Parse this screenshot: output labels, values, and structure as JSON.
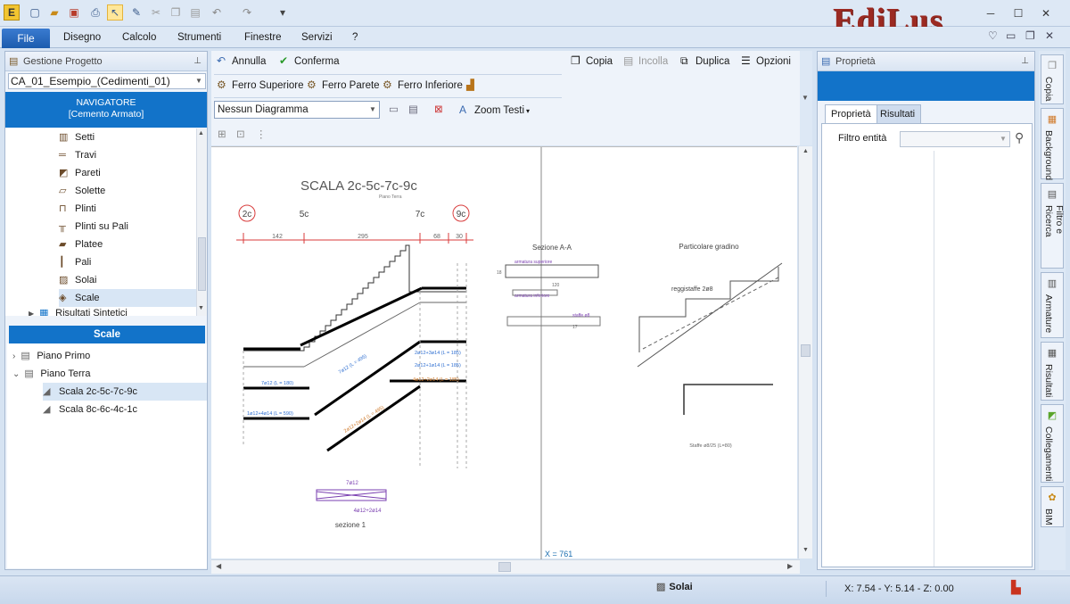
{
  "app": {
    "logo": "EdiLus"
  },
  "quick_access": {
    "icons": [
      "app-menu-icon",
      "new-icon",
      "open-icon",
      "save-icon",
      "print-icon",
      "select-icon",
      "tool-icon",
      "cut-icon",
      "copy-icon",
      "paste-icon",
      "undo-icon",
      "redo-icon",
      "customize-icon"
    ]
  },
  "menu": {
    "file": "File",
    "items": [
      "Disegno",
      "Calcolo",
      "Strumenti",
      "Finestre",
      "Servizi",
      "?"
    ]
  },
  "left_panel": {
    "header": "Gestione Progetto",
    "project_combo": "CA_01_Esempio_(Cedimenti_01)",
    "navigator_title": "NAVIGATORE",
    "navigator_subtitle": "[Cemento Armato]",
    "tree_items": [
      "Setti",
      "Travi",
      "Pareti",
      "Solette",
      "Plinti",
      "Plinti su Pali",
      "Platee",
      "Pali",
      "Solai",
      "Scale",
      "Risultati Sintetici"
    ],
    "scale_header": "Scale",
    "scale_tree": {
      "piano_primo": "Piano Primo",
      "piano_terra": "Piano Terra",
      "items": [
        "Scala 2c-5c-7c-9c",
        "Scala 8c-6c-4c-1c"
      ]
    }
  },
  "toolbar": {
    "annulla": "Annulla",
    "conferma": "Conferma",
    "copia": "Copia",
    "incolla": "Incolla",
    "duplica": "Duplica",
    "opzioni": "Opzioni",
    "ferro_superiore": "Ferro Superiore",
    "ferro_parete": "Ferro Parete",
    "ferro_inferiore": "Ferro Inferiore",
    "diagram_combo": "Nessun Diagramma",
    "zoom_testi": "Zoom Testi"
  },
  "drawing": {
    "title": "SCALA 2c-5c-7c-9c",
    "subtitle": "Piano Terra",
    "columns": [
      "2c",
      "5c",
      "7c",
      "9c"
    ],
    "dims": [
      "142",
      "295",
      "68",
      "30"
    ],
    "section_aa": "Sezione A-A",
    "gradino": "Particolare gradino",
    "reggistaffe": "reggistaffe 2ø8",
    "staffe": "Staffe ø8/25 (L=80)",
    "sezione1": "sezione 1",
    "sez1_top": "7ø12",
    "sez1_bottom": "4ø12+2ø14",
    "rebar_labels": [
      "7ø12 (L = 180)",
      "1ø12+4ø14 (L = 590)",
      "7ø12 (L = 495)",
      "2ø12+2ø14 (L = 495)",
      "2ø12+3ø14 (L = 185)",
      "4ø12+2ø14 (L = 185)",
      "2ø12+1ø14 (L = 185)"
    ],
    "section_labels": [
      "armatura superiore",
      "armatura inferiore",
      "staffe ø8",
      "120",
      "18",
      "17"
    ],
    "cursor_readout": "X = 761"
  },
  "right_panel": {
    "header": "Proprietà",
    "tabs": [
      "Proprietà",
      "Risultati"
    ],
    "filter_label": "Filtro entità",
    "filter_value": ""
  },
  "side_tabs": [
    "Copia",
    "Background",
    "Filtro e Ricerca",
    "Armature",
    "Risultati",
    "Collegamenti",
    "BIM"
  ],
  "status": {
    "mode": "Solai",
    "coords": "X: 7.54 - Y: 5.14 - Z: 0.00"
  },
  "colors": {
    "accent_blue": "#1273c9",
    "logo_red": "#9b2a22",
    "panel_bg": "#eef3fa",
    "rebar_blue": "#2f6fd1",
    "rebar_orange": "#d07a2a",
    "dim_red": "#d83b3b",
    "sect_purple": "#7a3fb0"
  }
}
